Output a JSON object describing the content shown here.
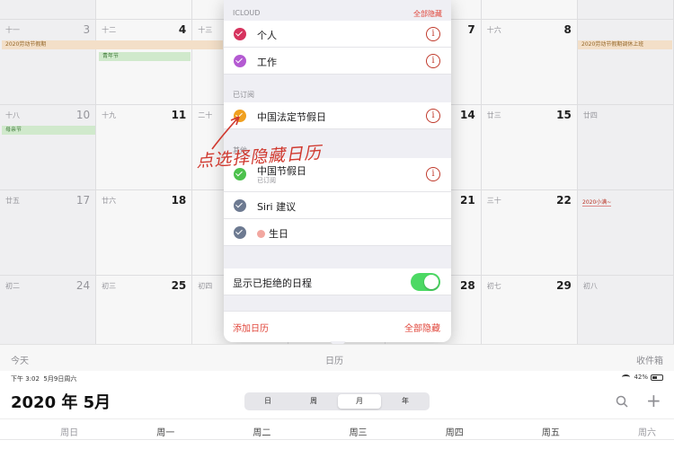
{
  "calendar_grid": {
    "rows": [
      [
        {
          "lunar": "十一",
          "day": "3",
          "weekend": true
        },
        {
          "lunar": "十二",
          "day": "4"
        },
        {
          "lunar": "十三",
          "day": ""
        },
        {
          "lunar": "",
          "day": ""
        },
        {
          "lunar": "",
          "day": "7"
        },
        {
          "lunar": "十六",
          "day": "8"
        },
        {
          "lunar": "",
          "day": "",
          "weekend": true
        }
      ],
      [
        {
          "lunar": "十八",
          "day": "10",
          "weekend": true
        },
        {
          "lunar": "十九",
          "day": "11"
        },
        {
          "lunar": "二十",
          "day": ""
        },
        {
          "lunar": "",
          "day": ""
        },
        {
          "lunar": "",
          "day": "14"
        },
        {
          "lunar": "廿三",
          "day": "15"
        },
        {
          "lunar": "廿四",
          "day": "",
          "weekend": true
        }
      ],
      [
        {
          "lunar": "廿五",
          "day": "17",
          "weekend": true
        },
        {
          "lunar": "廿六",
          "day": "18"
        },
        {
          "lunar": "",
          "day": ""
        },
        {
          "lunar": "",
          "day": ""
        },
        {
          "lunar": "",
          "day": "21"
        },
        {
          "lunar": "三十",
          "day": "22"
        },
        {
          "lunar": "",
          "day": "",
          "weekend": true
        }
      ],
      [
        {
          "lunar": "初二",
          "day": "24",
          "weekend": true
        },
        {
          "lunar": "初三",
          "day": "25"
        },
        {
          "lunar": "初四",
          "day": ""
        },
        {
          "lunar": "",
          "day": ""
        },
        {
          "lunar": "",
          "day": "28"
        },
        {
          "lunar": "初七",
          "day": "29"
        },
        {
          "lunar": "初八",
          "day": "",
          "weekend": true
        }
      ]
    ],
    "events": {
      "labor_day_left": "2020劳动节假期",
      "youth_day": "青年节",
      "mothers_day": "母亲节",
      "labor_day_right": "2020劳动节假期调休上班",
      "small_full": "2020小满~"
    }
  },
  "popover": {
    "icloud_header": "ICLOUD",
    "hide_all_top": "全部隐藏",
    "subscribed_header": "已订阅",
    "other_header": "其他",
    "items": [
      {
        "label": "个人",
        "color": "#d6335e"
      },
      {
        "label": "工作",
        "color": "#b45ad2"
      },
      {
        "label": "中国法定节假日",
        "color": "#f0a020"
      },
      {
        "label": "中国节假日",
        "sublabel": "已订阅",
        "color": "#4cc14c"
      },
      {
        "label": "Siri 建议",
        "color": "#6d7a91"
      },
      {
        "label": "生日",
        "color": "#6d7a91"
      }
    ],
    "show_declined": "显示已拒绝的日程",
    "add_calendar": "添加日历",
    "hide_all_bottom": "全部隐藏"
  },
  "annotation": "点选择隐藏日历",
  "toolbar": {
    "today": "今天",
    "calendars": "日历",
    "inbox": "收件箱"
  },
  "statusbar": {
    "time": "下午 3:02",
    "date": "5月9日周六",
    "battery": "42%"
  },
  "header": {
    "month_title": "2020 年 5月",
    "segments": [
      "日",
      "周",
      "月",
      "年"
    ],
    "active_segment": "月"
  },
  "weekdays": [
    "周日",
    "周一",
    "周二",
    "周三",
    "周四",
    "周五",
    "周六"
  ],
  "colors": {
    "accent": "#e0453a",
    "toggle_on": "#4cd964"
  }
}
